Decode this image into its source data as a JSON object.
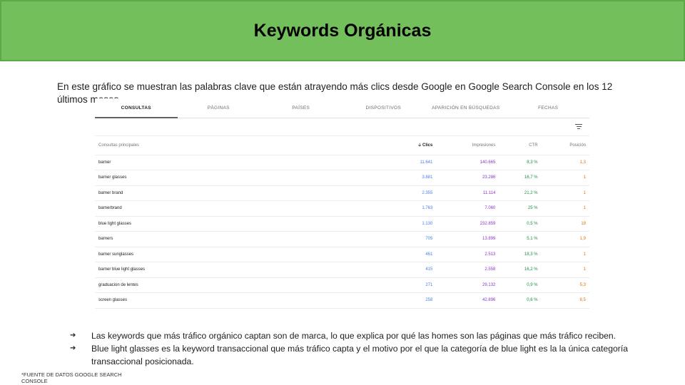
{
  "slide": {
    "title": "Keywords Orgánicas",
    "intro": "En este gráfico se muestran las palabras clave que están atrayendo más clics desde Google en Google Search Console en los 12 últimos meses.",
    "footnote": "*FUENTE DE DATOS GOOGLE SEARCH CONSOLE"
  },
  "gsc": {
    "tabs": [
      "CONSULTAS",
      "PÁGINAS",
      "PAÍSES",
      "DISPOSITIVOS",
      "APARICIÓN EN BÚSQUEDAS",
      "FECHAS"
    ],
    "active_tab": "CONSULTAS",
    "columns": {
      "query": "Consultas principales",
      "clicks": "Clics",
      "impressions": "Impresiones",
      "ctr": "CTR",
      "position": "Posición"
    },
    "sort_icon": "arrow-down-icon",
    "filter_icon": "filter-icon",
    "colors": {
      "clicks": "#4a7fe8",
      "impressions": "#8b35c7",
      "ctr": "#1e8e3e",
      "position": "#e8710a"
    },
    "rows": [
      {
        "query": "barner",
        "clicks": "11.641",
        "impressions": "140.665",
        "ctr": "8,3 %",
        "position": "1,3"
      },
      {
        "query": "barner glasses",
        "clicks": "3.881",
        "impressions": "23.286",
        "ctr": "16,7 %",
        "position": "1"
      },
      {
        "query": "barner brand",
        "clicks": "2.355",
        "impressions": "11.114",
        "ctr": "21,2 %",
        "position": "1"
      },
      {
        "query": "barnerbrand",
        "clicks": "1.763",
        "impressions": "7.060",
        "ctr": "25 %",
        "position": "1"
      },
      {
        "query": "blue light glasses",
        "clicks": "1.130",
        "impressions": "232.859",
        "ctr": "0,5 %",
        "position": "19"
      },
      {
        "query": "barners",
        "clicks": "705",
        "impressions": "13.899",
        "ctr": "5,1 %",
        "position": "1,9"
      },
      {
        "query": "barner sunglasses",
        "clicks": "461",
        "impressions": "2.513",
        "ctr": "18,3 %",
        "position": "1"
      },
      {
        "query": "barner blue light glasses",
        "clicks": "415",
        "impressions": "2.558",
        "ctr": "16,2 %",
        "position": "1"
      },
      {
        "query": "graduacion de lentes",
        "clicks": "271",
        "impressions": "29.132",
        "ctr": "0,9 %",
        "position": "5,3"
      },
      {
        "query": "screen glasses",
        "clicks": "258",
        "impressions": "42.896",
        "ctr": "0,6 %",
        "position": "8,5"
      }
    ]
  },
  "bullets": [
    "Las keywords que más tráfico orgánico captan son de marca, lo que explica por qué las homes son las páginas que más tráfico reciben.",
    "Blue light glasses es la keyword transaccional que más tráfico capta y el motivo por el que la categoría de blue light es la la única categoría transaccional posicionada."
  ]
}
